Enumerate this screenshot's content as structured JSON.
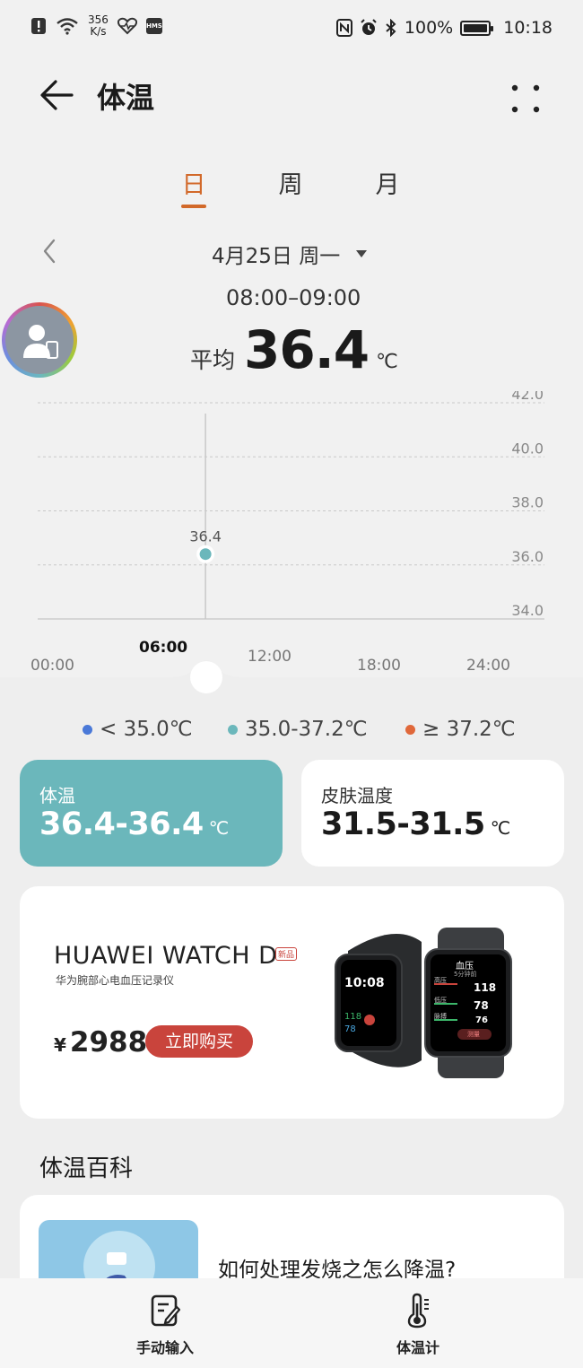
{
  "status_bar": {
    "net_speed_value": "356",
    "net_speed_unit": "K/s",
    "battery": "100%",
    "time": "10:18"
  },
  "header": {
    "title": "体温"
  },
  "tabs": [
    {
      "label": "日",
      "active": true
    },
    {
      "label": "周",
      "active": false
    },
    {
      "label": "月",
      "active": false
    }
  ],
  "date_selector": {
    "date": "4月25日 周一"
  },
  "summary": {
    "time_range": "08:00–09:00",
    "avg_label": "平均",
    "avg_value": "36.4",
    "unit": "℃"
  },
  "chart_data": {
    "type": "scatter",
    "x_ticks": [
      "00:00",
      "06:00",
      "12:00",
      "18:00",
      "24:00"
    ],
    "y_ticks": [
      "42.0",
      "40.0",
      "38.0",
      "36.0",
      "34.0"
    ],
    "ylim": [
      34.0,
      42.0
    ],
    "xlim": [
      0,
      24
    ],
    "points": [
      {
        "x": 8.5,
        "y": 36.4,
        "label": "36.4"
      }
    ],
    "selected_x_label": "06:00",
    "grid": true
  },
  "legend": [
    {
      "label": "< 35.0℃",
      "color": "#4a79d8"
    },
    {
      "label": "35.0-37.2℃",
      "color": "#6bb7bb"
    },
    {
      "label": "≥ 37.2℃",
      "color": "#e0683a"
    }
  ],
  "stats": {
    "body_temp_label": "体温",
    "body_temp_value": "36.4-36.4",
    "skin_temp_label": "皮肤温度",
    "skin_temp_value": "31.5-31.5",
    "unit": "℃"
  },
  "ad": {
    "product_name": "HUAWEI WATCH D",
    "new_badge": "新品",
    "subtitle": "华为腕部心电血压记录仪",
    "currency": "¥",
    "price": "2988",
    "buy_label": "立即购买",
    "watch_left": {
      "time": "10:08",
      "row1": "118",
      "row2": "78"
    },
    "watch_right": {
      "title": "血压",
      "sub": "5分钟前",
      "rows": [
        {
          "label": "高压",
          "value": "118"
        },
        {
          "label": "低压",
          "value": "78"
        },
        {
          "label": "脉搏",
          "value": "76"
        }
      ],
      "button": "测量"
    }
  },
  "encyclopedia": {
    "section_title": "体温百科",
    "article_title": "如何处理发烧之怎么降温?"
  },
  "bottom_bar": {
    "manual_input": "手动输入",
    "thermometer": "体温计"
  },
  "colors": {
    "accent_orange": "#d2692a",
    "teal_card": "#6bb7bb",
    "buy_red": "#c9443c"
  }
}
